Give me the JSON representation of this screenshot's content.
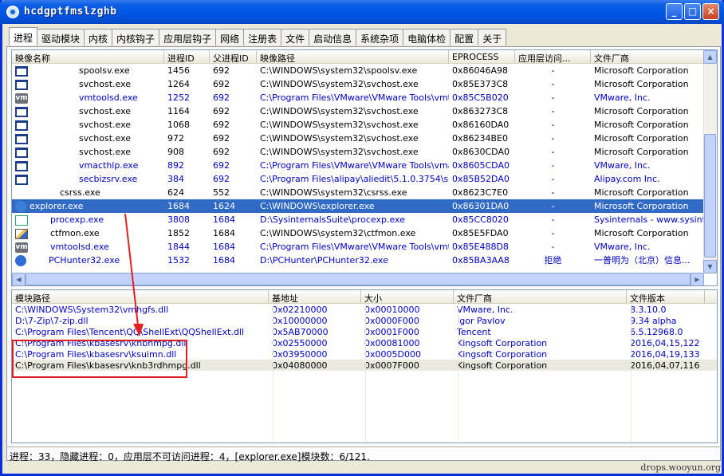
{
  "window": {
    "title": "hcdgptfmslzghb",
    "min_label": "_",
    "max_label": "□",
    "close_label": "×"
  },
  "tabs": [
    "进程",
    "驱动模块",
    "内核",
    "内核钩子",
    "应用层钩子",
    "网络",
    "注册表",
    "文件",
    "启动信息",
    "系统杂项",
    "电脑体检",
    "配置",
    "关于"
  ],
  "process_table": {
    "columns": [
      "映像名称",
      "进程ID",
      "父进程ID",
      "映像路径",
      "EPROCESS",
      "应用层访问...",
      "文件厂商"
    ],
    "rows": [
      {
        "icon": "window-icon",
        "name": "spoolsv.exe",
        "pid": "1456",
        "ppid": "692",
        "path": "C:\\WINDOWS\\system32\\spoolsv.exe",
        "eprocess": "0x86046A98",
        "access": "-",
        "vendor": "Microsoft Corporation",
        "color": "black"
      },
      {
        "icon": "window-icon",
        "name": "svchost.exe",
        "pid": "1264",
        "ppid": "692",
        "path": "C:\\WINDOWS\\system32\\svchost.exe",
        "eprocess": "0x85E373C8",
        "access": "-",
        "vendor": "Microsoft Corporation",
        "color": "black"
      },
      {
        "icon": "vm-icon",
        "name": "vmtoolsd.exe",
        "pid": "1252",
        "ppid": "692",
        "path": "C:\\Program Files\\VMware\\VMware Tools\\vmt...",
        "eprocess": "0x85C5B020",
        "access": "-",
        "vendor": "VMware, Inc.",
        "color": "blue"
      },
      {
        "icon": "window-icon",
        "name": "svchost.exe",
        "pid": "1164",
        "ppid": "692",
        "path": "C:\\WINDOWS\\system32\\svchost.exe",
        "eprocess": "0x863273C8",
        "access": "-",
        "vendor": "Microsoft Corporation",
        "color": "black"
      },
      {
        "icon": "window-icon",
        "name": "svchost.exe",
        "pid": "1068",
        "ppid": "692",
        "path": "C:\\WINDOWS\\system32\\svchost.exe",
        "eprocess": "0x86160DA0",
        "access": "-",
        "vendor": "Microsoft Corporation",
        "color": "black"
      },
      {
        "icon": "window-icon",
        "name": "svchost.exe",
        "pid": "972",
        "ppid": "692",
        "path": "C:\\WINDOWS\\system32\\svchost.exe",
        "eprocess": "0x86234BE0",
        "access": "-",
        "vendor": "Microsoft Corporation",
        "color": "black"
      },
      {
        "icon": "window-icon",
        "name": "svchost.exe",
        "pid": "908",
        "ppid": "692",
        "path": "C:\\WINDOWS\\system32\\svchost.exe",
        "eprocess": "0x8630CDA0",
        "access": "-",
        "vendor": "Microsoft Corporation",
        "color": "black"
      },
      {
        "icon": "window-icon",
        "name": "vmacthlp.exe",
        "pid": "892",
        "ppid": "692",
        "path": "C:\\Program Files\\VMware\\VMware Tools\\vma...",
        "eprocess": "0x8605CDA0",
        "access": "-",
        "vendor": "VMware, Inc.",
        "color": "blue"
      },
      {
        "icon": "window-icon",
        "name": "secbizsrv.exe",
        "pid": "384",
        "ppid": "692",
        "path": "C:\\Program Files\\alipay\\aliedit\\5.1.0.3754\\se...",
        "eprocess": "0x85B52DA0",
        "access": "-",
        "vendor": "Alipay.com Inc.",
        "color": "blue"
      },
      {
        "icon": "none",
        "name": "csrss.exe",
        "pid": "624",
        "ppid": "552",
        "path": "C:\\WINDOWS\\system32\\csrss.exe",
        "eprocess": "0x8623C7E0",
        "access": "-",
        "vendor": "Microsoft Corporation",
        "color": "black"
      },
      {
        "icon": "explorer-icon",
        "name": "explorer.exe",
        "pid": "1684",
        "ppid": "1624",
        "path": "C:\\WINDOWS\\explorer.exe",
        "eprocess": "0x86301DA0",
        "access": "-",
        "vendor": "Microsoft Corporation",
        "color": "black"
      },
      {
        "icon": "procexp-icon",
        "name": "procexp.exe",
        "pid": "3808",
        "ppid": "1684",
        "path": "D:\\SysinternalsSuite\\procexp.exe",
        "eprocess": "0x85CC8020",
        "access": "-",
        "vendor": "Sysinternals - www.sysinte...",
        "color": "blue"
      },
      {
        "icon": "ctfmon-icon",
        "name": "ctfmon.exe",
        "pid": "1852",
        "ppid": "1684",
        "path": "C:\\WINDOWS\\system32\\ctfmon.exe",
        "eprocess": "0x85E5FDA0",
        "access": "-",
        "vendor": "Microsoft Corporation",
        "color": "black"
      },
      {
        "icon": "vm-icon",
        "name": "vmtoolsd.exe",
        "pid": "1844",
        "ppid": "1684",
        "path": "C:\\Program Files\\VMware\\VMware Tools\\vmt...",
        "eprocess": "0x85E488D8",
        "access": "-",
        "vendor": "VMware, Inc.",
        "color": "blue"
      },
      {
        "icon": "pchunter-icon",
        "name": "PCHunter32.exe",
        "pid": "1532",
        "ppid": "1684",
        "path": "D:\\PCHunter\\PCHunter32.exe",
        "eprocess": "0x85BA3AA8",
        "access": "拒绝",
        "vendor": "一普明为（北京）信息...",
        "color": "blue"
      }
    ],
    "selected_index": 10
  },
  "module_table": {
    "columns": [
      "模块路径",
      "基地址",
      "大小",
      "文件厂商",
      "文件版本"
    ],
    "rows": [
      {
        "path": "C:\\WINDOWS\\System32\\vmhgfs.dll",
        "base": "0x02210000",
        "size": "0x00010000",
        "vendor": "VMware, Inc.",
        "version": "8.3.10.0",
        "color": "blue"
      },
      {
        "path": "D:\\7-Zip\\7-zip.dll",
        "base": "0x10000000",
        "size": "0x0000F000",
        "vendor": "Igor Pavlov",
        "version": "9.34 alpha",
        "color": "blue"
      },
      {
        "path": "C:\\Program Files\\Tencent\\QQ\\ShellExt\\QQShellExt.dll",
        "base": "0x5AB70000",
        "size": "0x0001F000",
        "vendor": "Tencent",
        "version": "6.5.12968.0",
        "color": "blue"
      },
      {
        "path": "C:\\Program Files\\kbasesrv\\knbhmpg.dll",
        "base": "0x02550000",
        "size": "0x00081000",
        "vendor": "Kingsoft Corporation",
        "version": "2016,04,15,122",
        "color": "blue"
      },
      {
        "path": "C:\\Program Files\\kbasesrv\\ksuimn.dll",
        "base": "0x03950000",
        "size": "0x0005D000",
        "vendor": "Kingsoft Corporation",
        "version": "2016,04,19,133",
        "color": "blue"
      },
      {
        "path": "C:\\Program Files\\kbasesrv\\knb3rdhmpg.dll",
        "base": "0x04080000",
        "size": "0x0007F000",
        "vendor": "Kingsoft Corporation",
        "version": "2016,04,07,116",
        "color": "black"
      }
    ]
  },
  "status": "进程：33，隐藏进程：0，应用层不可访问进程：4，[explorer.exe]模块数：6/121.",
  "watermark": "drops.wooyun.org",
  "colors": {
    "selection": "#316ac5",
    "blue_text": "#0000c0",
    "highlight_box": "#e02020"
  }
}
